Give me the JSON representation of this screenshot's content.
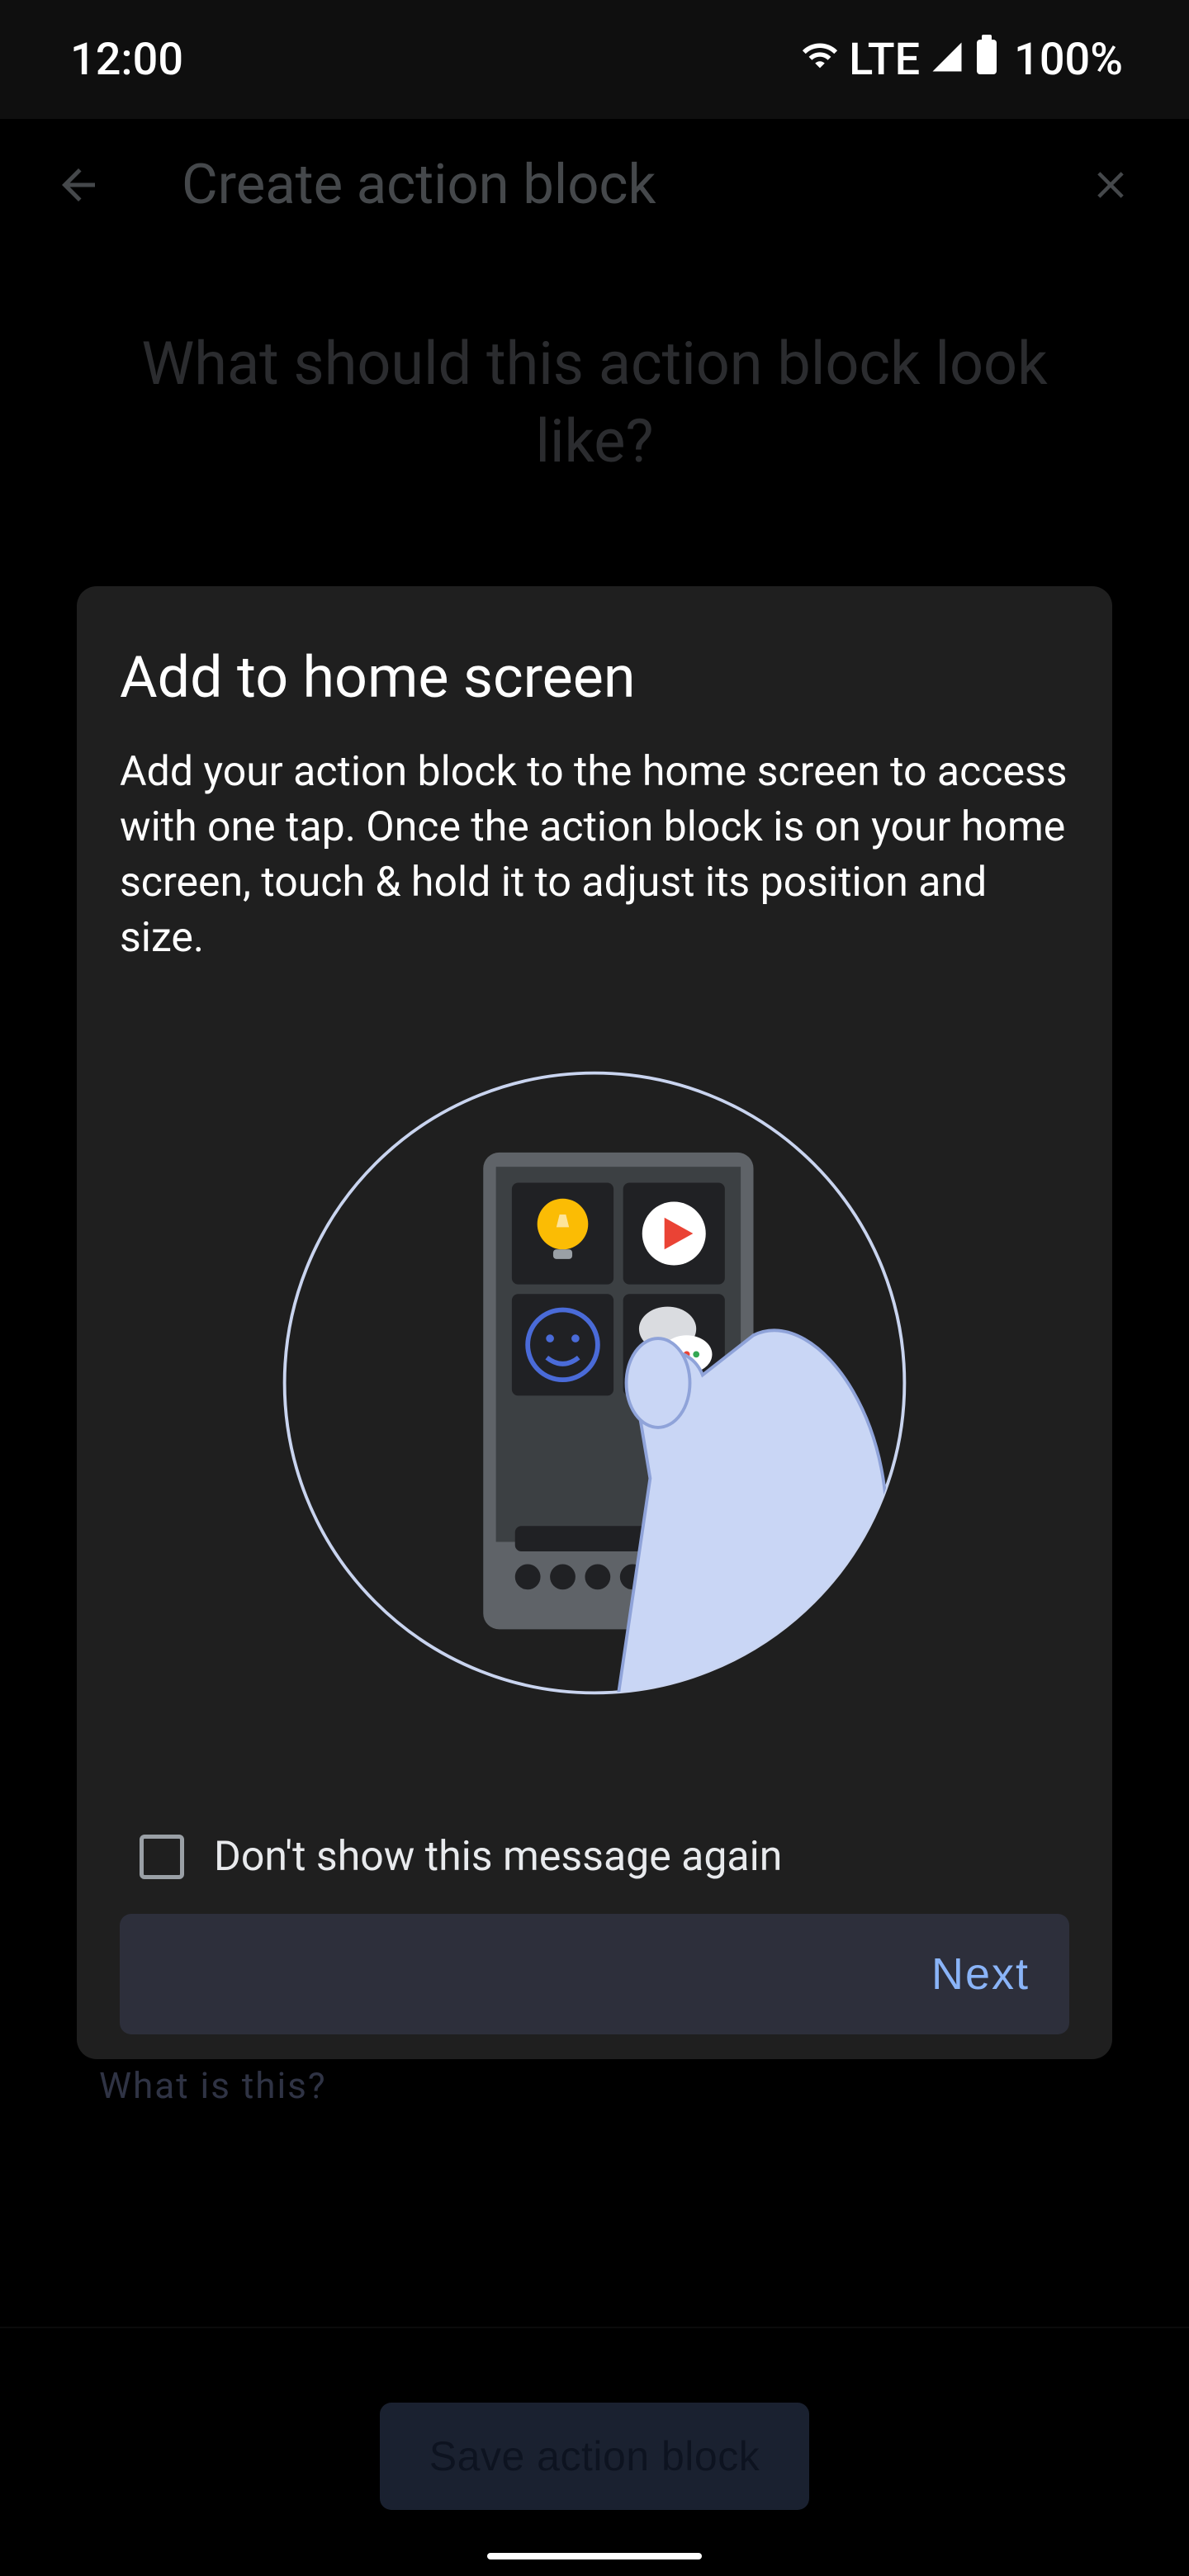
{
  "status_bar": {
    "time": "12:00",
    "network": "LTE",
    "battery": "100%"
  },
  "header": {
    "title": "Create action block"
  },
  "page": {
    "heading": "What should this action block look like?",
    "what_is_this": "What is this?"
  },
  "dialog": {
    "title": "Add to home screen",
    "body": "Add your action block to the home screen to access with one tap. Once the action block is on your home screen, touch & hold it to adjust its position and size.",
    "checkbox_label": "Don't show this message again",
    "next": "Next"
  },
  "footer": {
    "save": "Save action block"
  }
}
